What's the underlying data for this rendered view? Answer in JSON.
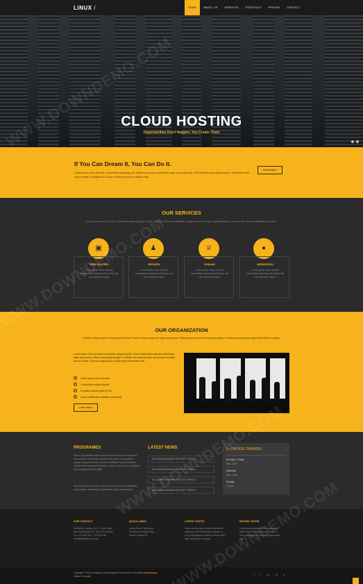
{
  "brand": {
    "name": "LINUX",
    "mark": "/"
  },
  "nav": [
    "HOME",
    "ABOUT US",
    "SERVICES",
    "PORTFOLIO",
    "PRICING",
    "CONTACT"
  ],
  "hero": {
    "title": "CLOUD HOSTING",
    "subtitle": "Opportunities Don't Happen, You Create Them"
  },
  "cta": {
    "title": "If You Can Dream It, You Can Do It.",
    "text": "Lorem ipsum dolor sit amet, consectetur adipiscing elit. Nullam quam arcu consectetur eget, accumsan sed. Sed tincidunt lacus eget posuere. Vestibulum ante ipsum primis in faucibus orci luctus et ultrices posuere cubilia curae.",
    "button": "Read More"
  },
  "services": {
    "title": "OUR SERVICES",
    "desc": "Lorem ipsum dolor sit amet, consectetur adipiscing elit. Donec quis nunc sit amet consectetur. Aliquam tincidunt lorem eget adipiscing. Vivamus vitae lectus sed dapibus posuere.",
    "items": [
      {
        "name": "WEB HOSTING",
        "icon": "book-icon",
        "text": "Lorem ipsum dolor sit amet consectetur adipiscing elit mauris sed nibh posuere magna."
      },
      {
        "name": "SERVERS",
        "icon": "users-icon",
        "text": "Lorem ipsum dolor sit amet consectetur adipiscing elit mauris sed nibh posuere magna."
      },
      {
        "name": "DOMAIN",
        "icon": "trophy-icon",
        "text": "Lorem ipsum dolor sit amet consectetur adipiscing elit mauris sed nibh posuere magna."
      },
      {
        "name": "WEBDESIGN",
        "icon": "globe-icon",
        "text": "Lorem ipsum dolor sit amet consectetur adipiscing elit mauris sed nibh posuere magna."
      }
    ]
  },
  "organization": {
    "title": "OUR ORGANIZATION",
    "desc": "Curabitur aliquet quam id dui posuere blandit. Donec rutrum congue leo eget malesuada. Pellentesque in ipsum id orci porta dapibus. Vivamus suscipit tortor eget felis porttitor volutpat.",
    "text": "Lorem ipsum dolor sit amet consectetur adipiscing elit. Donec sollicitudin molestie malesuada. Nulla quis lorem ut libero malesuada feugiat. Curabitur non nulla sit amet nisl tempus convallis quis ac lectus. Vivamus magna justo, lacinia eget consectetur sed.",
    "list": [
      "Lorem ipsum dolor sit amet",
      "Consectetur adipiscing elit",
      "Curabitur aliquet quam id dui",
      "Donec sollicitudin molestie malesuada"
    ],
    "button": "Learn More"
  },
  "programs": {
    "title": "PROGRAMES",
    "text1": "Sed ut perspiciatis unde omnis iste natus error sit voluptatem accusantium doloremque laudantium, totam rem aperiam, eaque ipsa quae ab illo inventore veritatis et quasi architecto beatae vitae dicta sunt explicabo. Nemo enim ipsam voluptatem quia voluptas sit aspernatur.",
    "text2": "Sed ut perspiciatis unde omnis iste natus error sit voluptatem accusantium doloremque laudantium totam rem aperiam."
  },
  "news": {
    "title": "LATEST NEWS",
    "items": [
      "ACCUMSAN MAURIS NECTEST ITEM # 1",
      "ACCUMSAN MAURIS NECTEST ITEM # 2",
      "ACCUMSAN MAURIS NECTEST ITEM # 3",
      "ACCUMSAN MAURIS NECTEST ITEM # 4"
    ]
  },
  "office": {
    "title": "OFFICE TIMINGS",
    "rows": [
      {
        "label": "Monday - Friday",
        "value": "9am - 6pm"
      },
      {
        "label": "Saturday",
        "value": "9am - 2pm"
      },
      {
        "label": "Sunday",
        "value": "Closed"
      }
    ]
  },
  "footer": {
    "cols": [
      {
        "title": "OUR CONTACT",
        "text": "Workshop Company Inc. 4, Tram Road, New World Street P.O. Box 123 Sweden US +123 456 789 / +100 123 456 email@domainname.com"
      },
      {
        "title": "QUICK LINKS",
        "text": "Latest Events Terms and Conditions Privacy Policy Career Contact Us"
      },
      {
        "title": "LATEST POSTS",
        "text": "Lorem ipsum dolor sit amet consectetur adipiscing elit Pellentesque in ipsum id orci porta dapibus Vivamus suscipit tortor eget felis porttitor volutpat"
      },
      {
        "title": "RECENT WORK",
        "text": "Lorem ipsum dolor sit amet consectetur adipiscing elit Pellentesque in ipsum id orci porta dapibus Vivamus suscipit tortor eget"
      }
    ]
  },
  "copyright": {
    "text": "Copyright © 2014 company name All rights reserved More Templates",
    "link": "Mobanwang",
    "suffix": "- Collect from",
    "link2": "cwd"
  },
  "social": [
    "f",
    "t",
    "g+",
    "in",
    "p"
  ],
  "watermark": "WWW.DOWNDEMO.COM",
  "colors": {
    "accent": "#f7b31b",
    "dark": "#2b2b2b"
  }
}
